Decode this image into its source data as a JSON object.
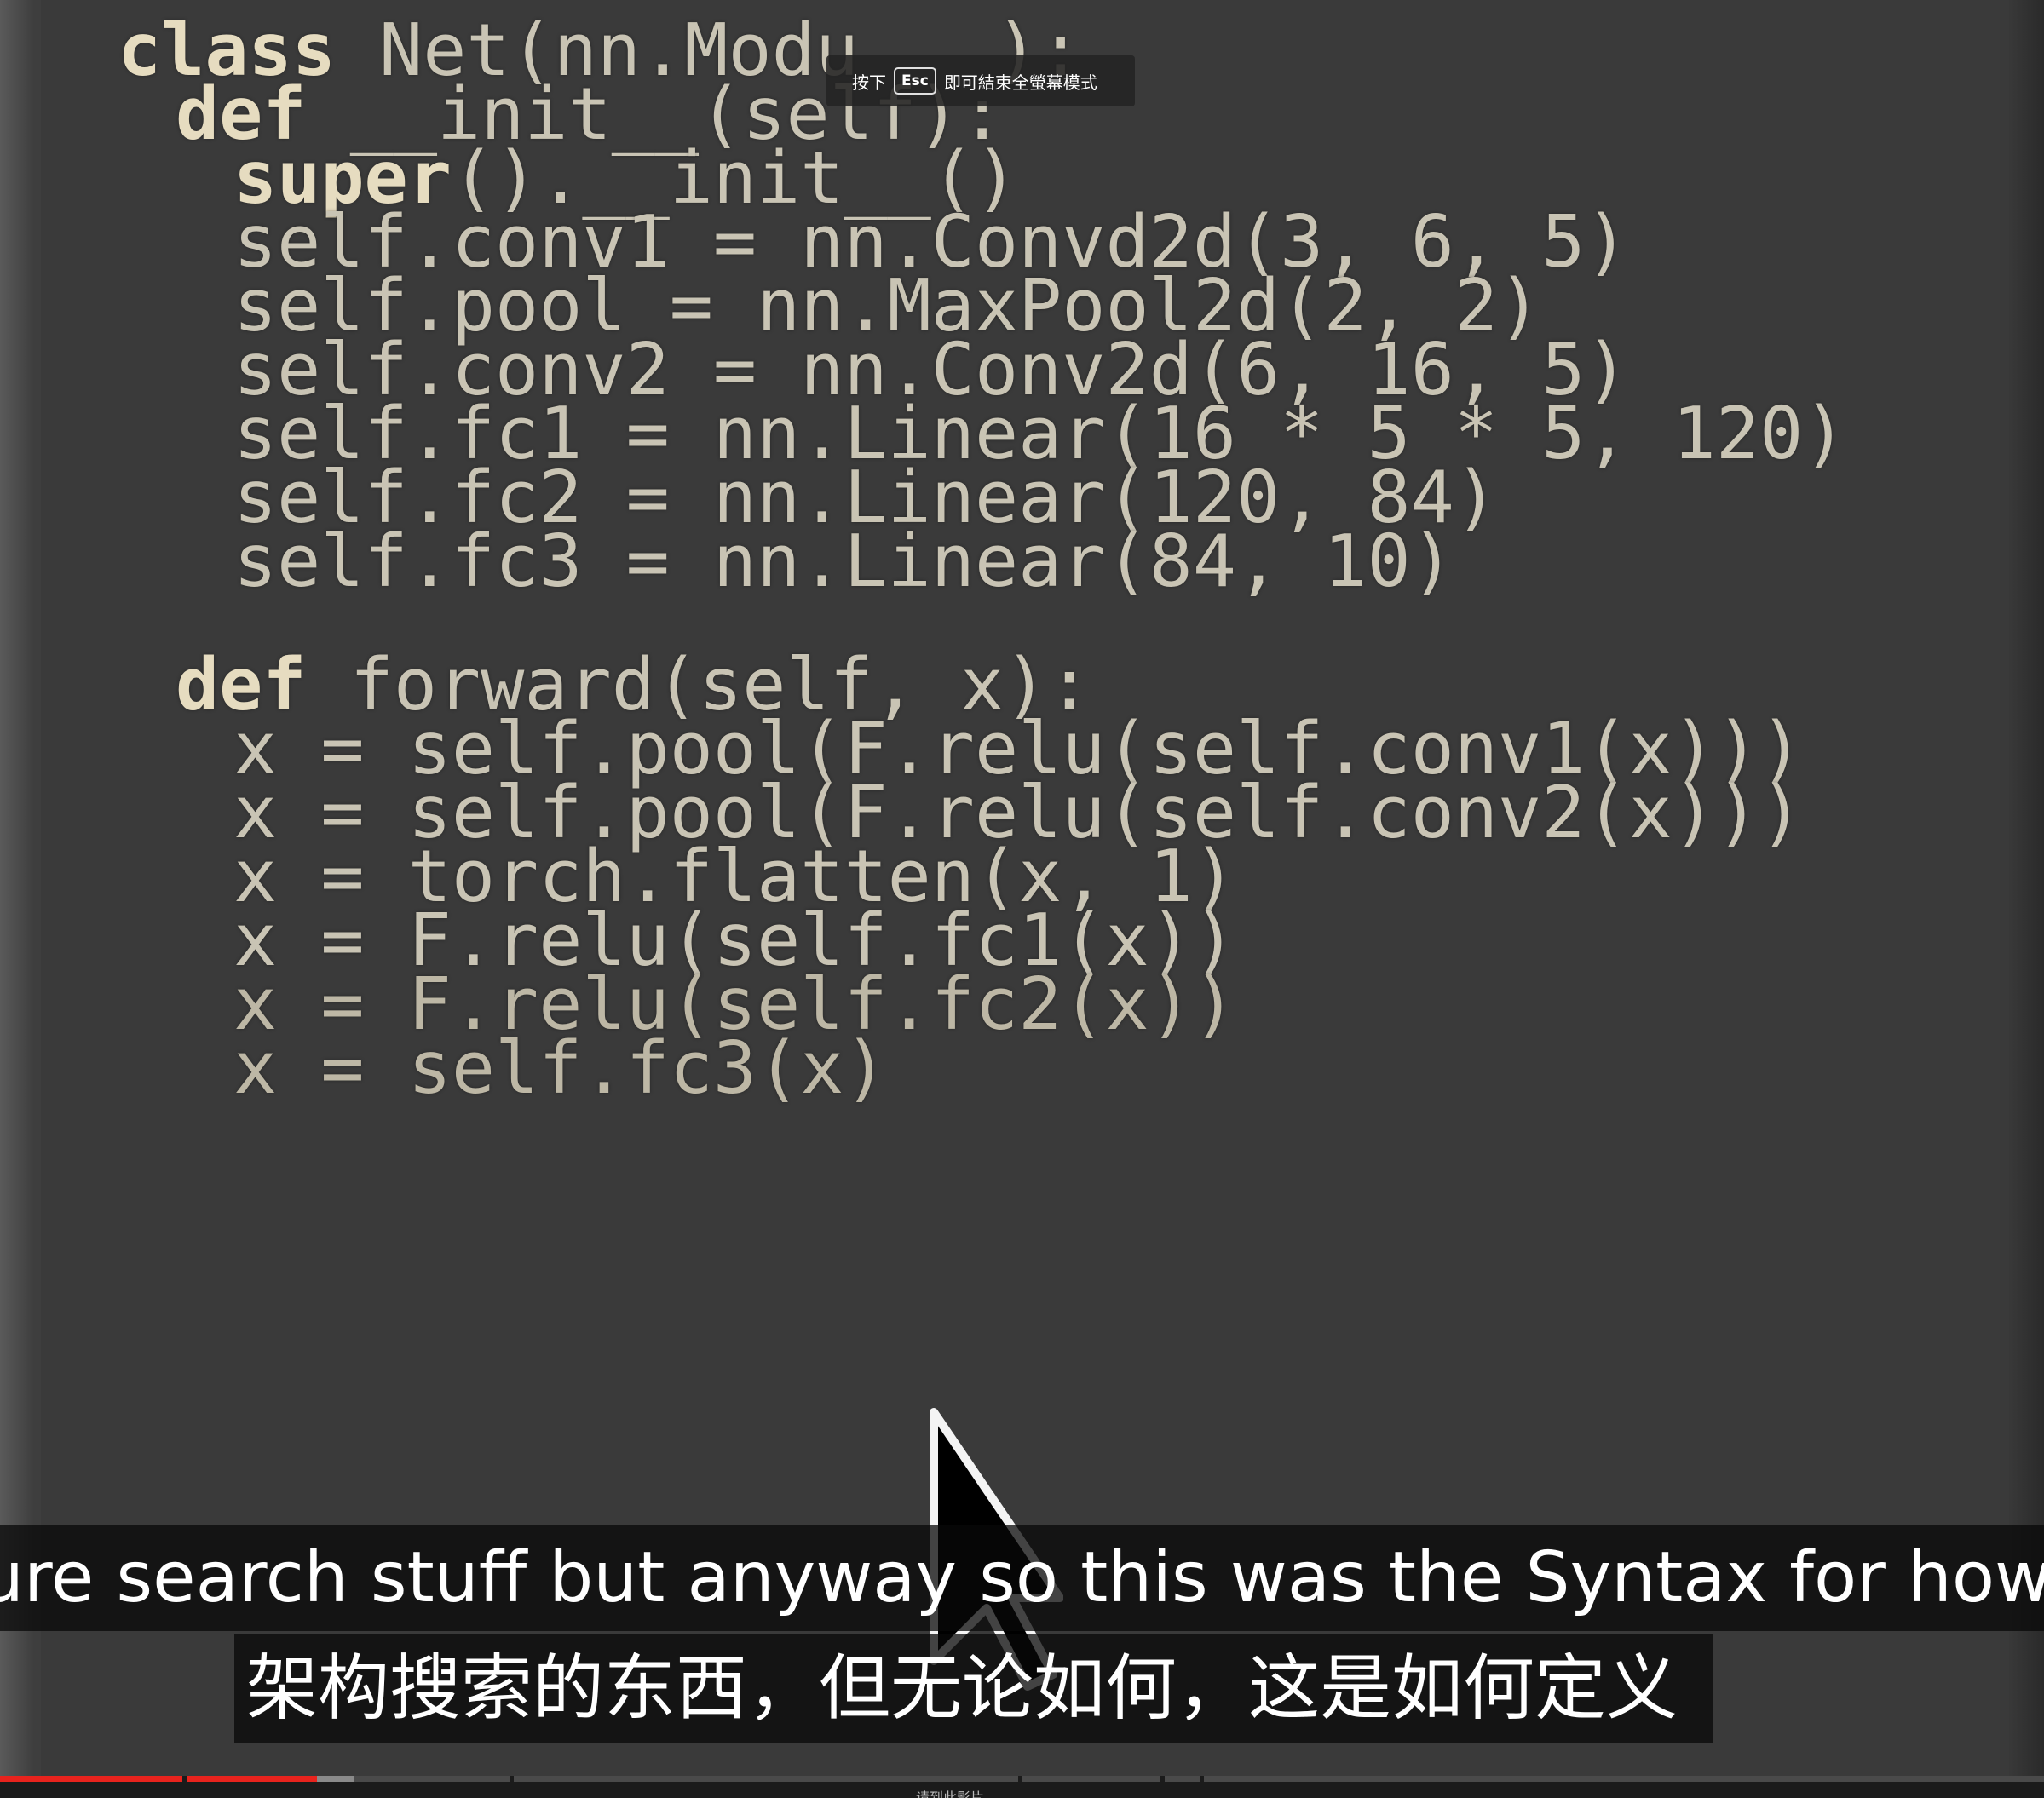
{
  "video": {
    "code_lines": [
      [
        "class",
        " Net(nn.Modu"
      ],
      [
        "def",
        " __init__(self):"
      ],
      [
        "super",
        "().__init__()"
      ],
      [
        "",
        "self.conv1 = nn.Convd2d(3, 6, 5)"
      ],
      [
        "",
        "self.pool = nn.MaxPool2d(2, 2)"
      ],
      [
        "",
        "self.conv2 = nn.Conv2d(6, 16, 5)"
      ],
      [
        "",
        "self.fc1 = nn.Linear(16 * 5 * 5, 120)"
      ],
      [
        "",
        "self.fc2 = nn.Linear(120, 84)"
      ],
      [
        "",
        "self.fc3 = nn.Linear(84, 10)"
      ],
      [
        "def",
        " forward(self, x):"
      ],
      [
        "",
        "x = self.pool(F.relu(self.conv1(x)))"
      ],
      [
        "",
        "x = self.pool(F.relu(self.conv2(x)))"
      ],
      [
        "",
        "x = torch.flatten(x, 1)"
      ],
      [
        "",
        "x = F.relu(self.fc1(x))"
      ],
      [
        "",
        "x = F.relu(self.fc2(x))"
      ],
      [
        "",
        "x = self.fc3(x)"
      ]
    ],
    "code_line_partial_tail": "):"
  },
  "fullscreen_hint": {
    "prefix": "按下",
    "key": "Esc",
    "suffix": "即可結束全螢幕模式"
  },
  "captions": {
    "english": "ure search stuff but anyway so this was the Syntax for how you d",
    "chinese": "架构搜索的东西，但无论如何，这是如何定义"
  },
  "progress": {
    "played_fraction": 0.155,
    "buffered_fraction": 0.173,
    "chapter_label": "请到此影片"
  },
  "colors": {
    "played": "#e8231d",
    "code_text": "#c9c4b4",
    "keyword": "#e6dcc0"
  }
}
